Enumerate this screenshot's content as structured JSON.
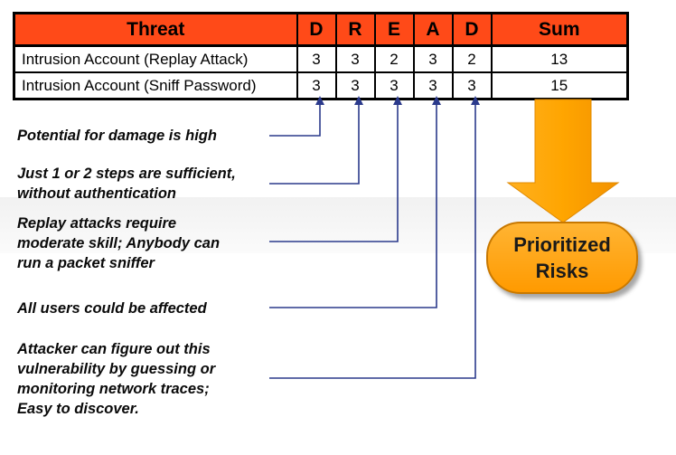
{
  "table": {
    "headers": [
      "Threat",
      "D",
      "R",
      "E",
      "A",
      "D",
      "Sum"
    ],
    "rows": [
      {
        "threat": "Intrusion Account (Replay Attack)",
        "d": "3",
        "r": "3",
        "e": "2",
        "a": "3",
        "d2": "2",
        "sum": "13"
      },
      {
        "threat": "Intrusion Account (Sniff Password)",
        "d": "3",
        "r": "3",
        "e": "3",
        "a": "3",
        "d2": "3",
        "sum": "15"
      }
    ]
  },
  "notes": [
    "Potential for damage is high",
    "Just 1 or 2 steps are sufficient,\nwithout authentication",
    "Replay attacks require\nmoderate skill; Anybody can\nrun a packet sniffer",
    "All users could be affected",
    "Attacker can figure out this\nvulnerability by guessing or\nmonitoring network traces;\nEasy to discover."
  ],
  "result": {
    "label": "Prioritized\nRisks"
  },
  "colors": {
    "header_bg": "#ff4a18",
    "connector": "#2b3a8c",
    "arrow": "#ffa000",
    "badge": "#ffa500"
  }
}
